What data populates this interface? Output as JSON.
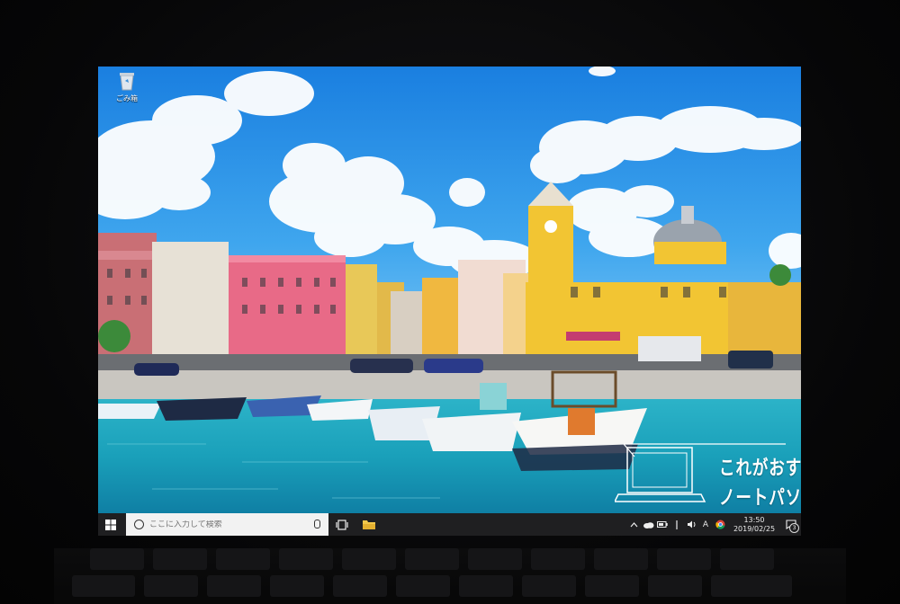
{
  "desktop": {
    "recycle_bin_label": "ごみ箱",
    "icons": {
      "recycle_bin": "recycle-bin-icon"
    }
  },
  "promo": {
    "line1": "これがおすすめ",
    "line2": "ノートパソコン",
    "icon": "laptop-icon"
  },
  "taskbar": {
    "start_icon": "windows-logo-icon",
    "search": {
      "placeholder": "ここに入力して検索",
      "value": ""
    },
    "pinned": [
      "task-view-icon",
      "file-explorer-icon"
    ],
    "tray": {
      "icons": [
        "chevron-up-icon",
        "onedrive-icon",
        "battery-icon",
        "network-icon",
        "volume-icon",
        "ime-icon",
        "chrome-icon"
      ],
      "ime_label": "A",
      "time": "13:50",
      "date": "2019/02/25",
      "notification_count": "3"
    }
  },
  "colors": {
    "taskbar_bg": "#1f1f21",
    "search_bg": "#f2f2f2",
    "sky": "#2a8fe0",
    "sea": "#1fb0c4"
  }
}
